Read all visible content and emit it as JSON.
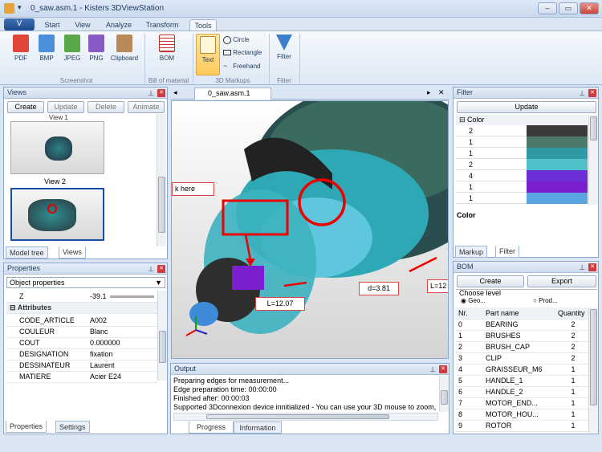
{
  "window": {
    "title": "0_saw.asm.1 - Kisters 3DViewStation",
    "min": "–",
    "max": "▭",
    "close": "✕"
  },
  "app_button": "V",
  "tabs": [
    "Start",
    "View",
    "Analyze",
    "Transform",
    "Tools"
  ],
  "ribbon": {
    "screenshot": {
      "items": [
        "PDF",
        "BMP",
        "JPEG",
        "PNG",
        "Clipboard"
      ],
      "group": "Screenshot"
    },
    "bom": {
      "item": "BOM",
      "group": "Bill of material"
    },
    "markups": {
      "text": "Text",
      "circle": "Circle",
      "rectangle": "Rectangle",
      "freehand": "Freehand",
      "group": "3D Markups"
    },
    "filter": {
      "item": "Filter",
      "group": "Filter"
    }
  },
  "views": {
    "title": "Views",
    "buttons": [
      "Create",
      "Update",
      "Delete",
      "Animate"
    ],
    "view_label": "View 2",
    "top_label": "View 1",
    "tabs": [
      "Model tree",
      "Views"
    ]
  },
  "properties": {
    "title": "Properties",
    "dropdown": "Object properties",
    "z_label": "Z",
    "z_value": "-39.1",
    "section": "Attributes",
    "rows": [
      [
        "CODE_ARTICLE",
        "A002"
      ],
      [
        "COULEUR",
        "Blanc"
      ],
      [
        "COUT",
        "0.000000"
      ],
      [
        "DESIGNATION",
        "fixation"
      ],
      [
        "DESSINATEUR",
        "Laurent"
      ],
      [
        "MATIERE",
        "Acier E24"
      ]
    ],
    "tabs": [
      "Properties",
      "Settings"
    ]
  },
  "viewport": {
    "tab": "0_saw.asm.1",
    "click_here": "k here",
    "dim1": "L=12.07",
    "dim2": "d=3.81",
    "dim3": "L=12"
  },
  "output": {
    "title": "Output",
    "lines": [
      "Preparing edges for measurement...",
      "Edge preparation time: 00:00:00",
      "Finished after: 00:00:03",
      "Supported 3Dconnexion device innitialized - You can use your 3D mouse to zoom, pan, o"
    ],
    "tabs": [
      "Progress",
      "Information"
    ]
  },
  "filter": {
    "title": "Filter",
    "update": "Update",
    "col": "Color",
    "rows": [
      {
        "n": "2",
        "c": "#3b3b3b"
      },
      {
        "n": "1",
        "c": "#4d7a69"
      },
      {
        "n": "1",
        "c": "#2f9aa5"
      },
      {
        "n": "2",
        "c": "#4fc0c7"
      },
      {
        "n": "4",
        "c": "#6a2fd6"
      },
      {
        "n": "1",
        "c": "#7a1fd0"
      },
      {
        "n": "1",
        "c": "#5aa4e0"
      }
    ],
    "footer": "Color",
    "tabs": [
      "Markup",
      "Filter"
    ]
  },
  "bom": {
    "title": "BOM",
    "create": "Create",
    "export": "Export",
    "level_label": "Choose level",
    "level_geo": "Geo...",
    "level_prod": "Prod...",
    "headers": [
      "Nr.",
      "Part name",
      "Quantity"
    ],
    "rows": [
      [
        "0",
        "BEARING",
        "2"
      ],
      [
        "1",
        "BRUSHES",
        "2"
      ],
      [
        "2",
        "BRUSH_CAP",
        "2"
      ],
      [
        "3",
        "CLIP",
        "2"
      ],
      [
        "4",
        "GRAISSEUR_M6",
        "1"
      ],
      [
        "5",
        "HANDLE_1",
        "1"
      ],
      [
        "6",
        "HANDLE_2",
        "1"
      ],
      [
        "7",
        "MOTOR_END...",
        "1"
      ],
      [
        "8",
        "MOTOR_HOU...",
        "1"
      ],
      [
        "9",
        "ROTOR",
        "1"
      ]
    ]
  }
}
